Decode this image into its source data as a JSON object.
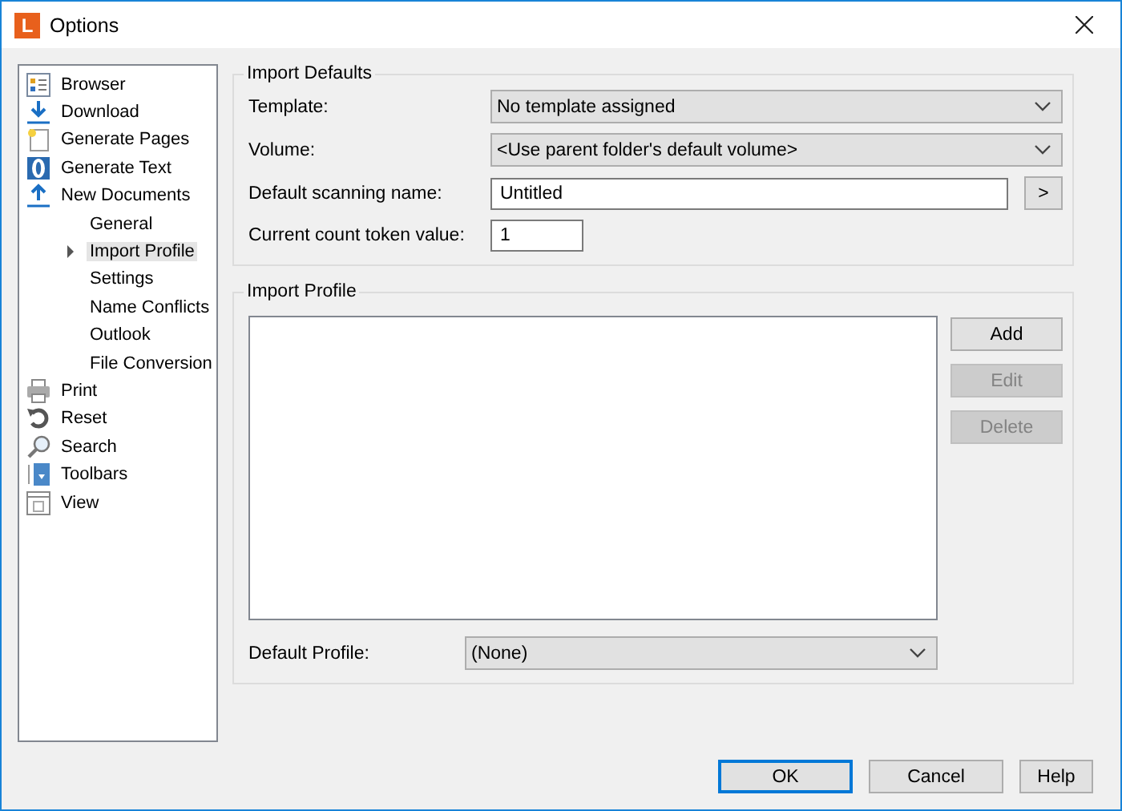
{
  "window": {
    "title": "Options",
    "icon_letter": "L"
  },
  "sidebar": {
    "items": [
      {
        "label": "Browser",
        "selected": false
      },
      {
        "label": "Download",
        "selected": false
      },
      {
        "label": "Generate Pages",
        "selected": false
      },
      {
        "label": "Generate Text",
        "selected": false
      },
      {
        "label": "New Documents",
        "selected": false,
        "children": [
          {
            "label": "General",
            "selected": false
          },
          {
            "label": "Import Profile",
            "selected": true,
            "expanded": false
          },
          {
            "label": "Settings",
            "selected": false
          },
          {
            "label": "Name Conflicts",
            "selected": false
          },
          {
            "label": "Outlook",
            "selected": false
          },
          {
            "label": "File Conversion",
            "selected": false
          }
        ]
      },
      {
        "label": "Print",
        "selected": false
      },
      {
        "label": "Reset",
        "selected": false
      },
      {
        "label": "Search",
        "selected": false
      },
      {
        "label": "Toolbars",
        "selected": false
      },
      {
        "label": "View",
        "selected": false
      }
    ]
  },
  "import_defaults": {
    "title": "Import Defaults",
    "template": {
      "label": "Template:",
      "value": "No template assigned"
    },
    "volume": {
      "label": "Volume:",
      "value": "<Use parent folder's default volume>"
    },
    "scanning_name": {
      "label": "Default scanning name:",
      "value": "Untitled",
      "button": ">"
    },
    "count_token": {
      "label": "Current count token value:",
      "value": "1"
    }
  },
  "import_profile": {
    "title": "Import Profile",
    "buttons": [
      {
        "label": "Add",
        "disabled": false
      },
      {
        "label": "Edit",
        "disabled": true
      },
      {
        "label": "Delete",
        "disabled": true
      }
    ],
    "default_profile": {
      "label": "Default Profile:",
      "value": "(None)"
    }
  },
  "buttons": [
    {
      "label": "OK",
      "default": true
    },
    {
      "label": "Cancel",
      "default": false
    },
    {
      "label": "Help",
      "default": false
    }
  ]
}
